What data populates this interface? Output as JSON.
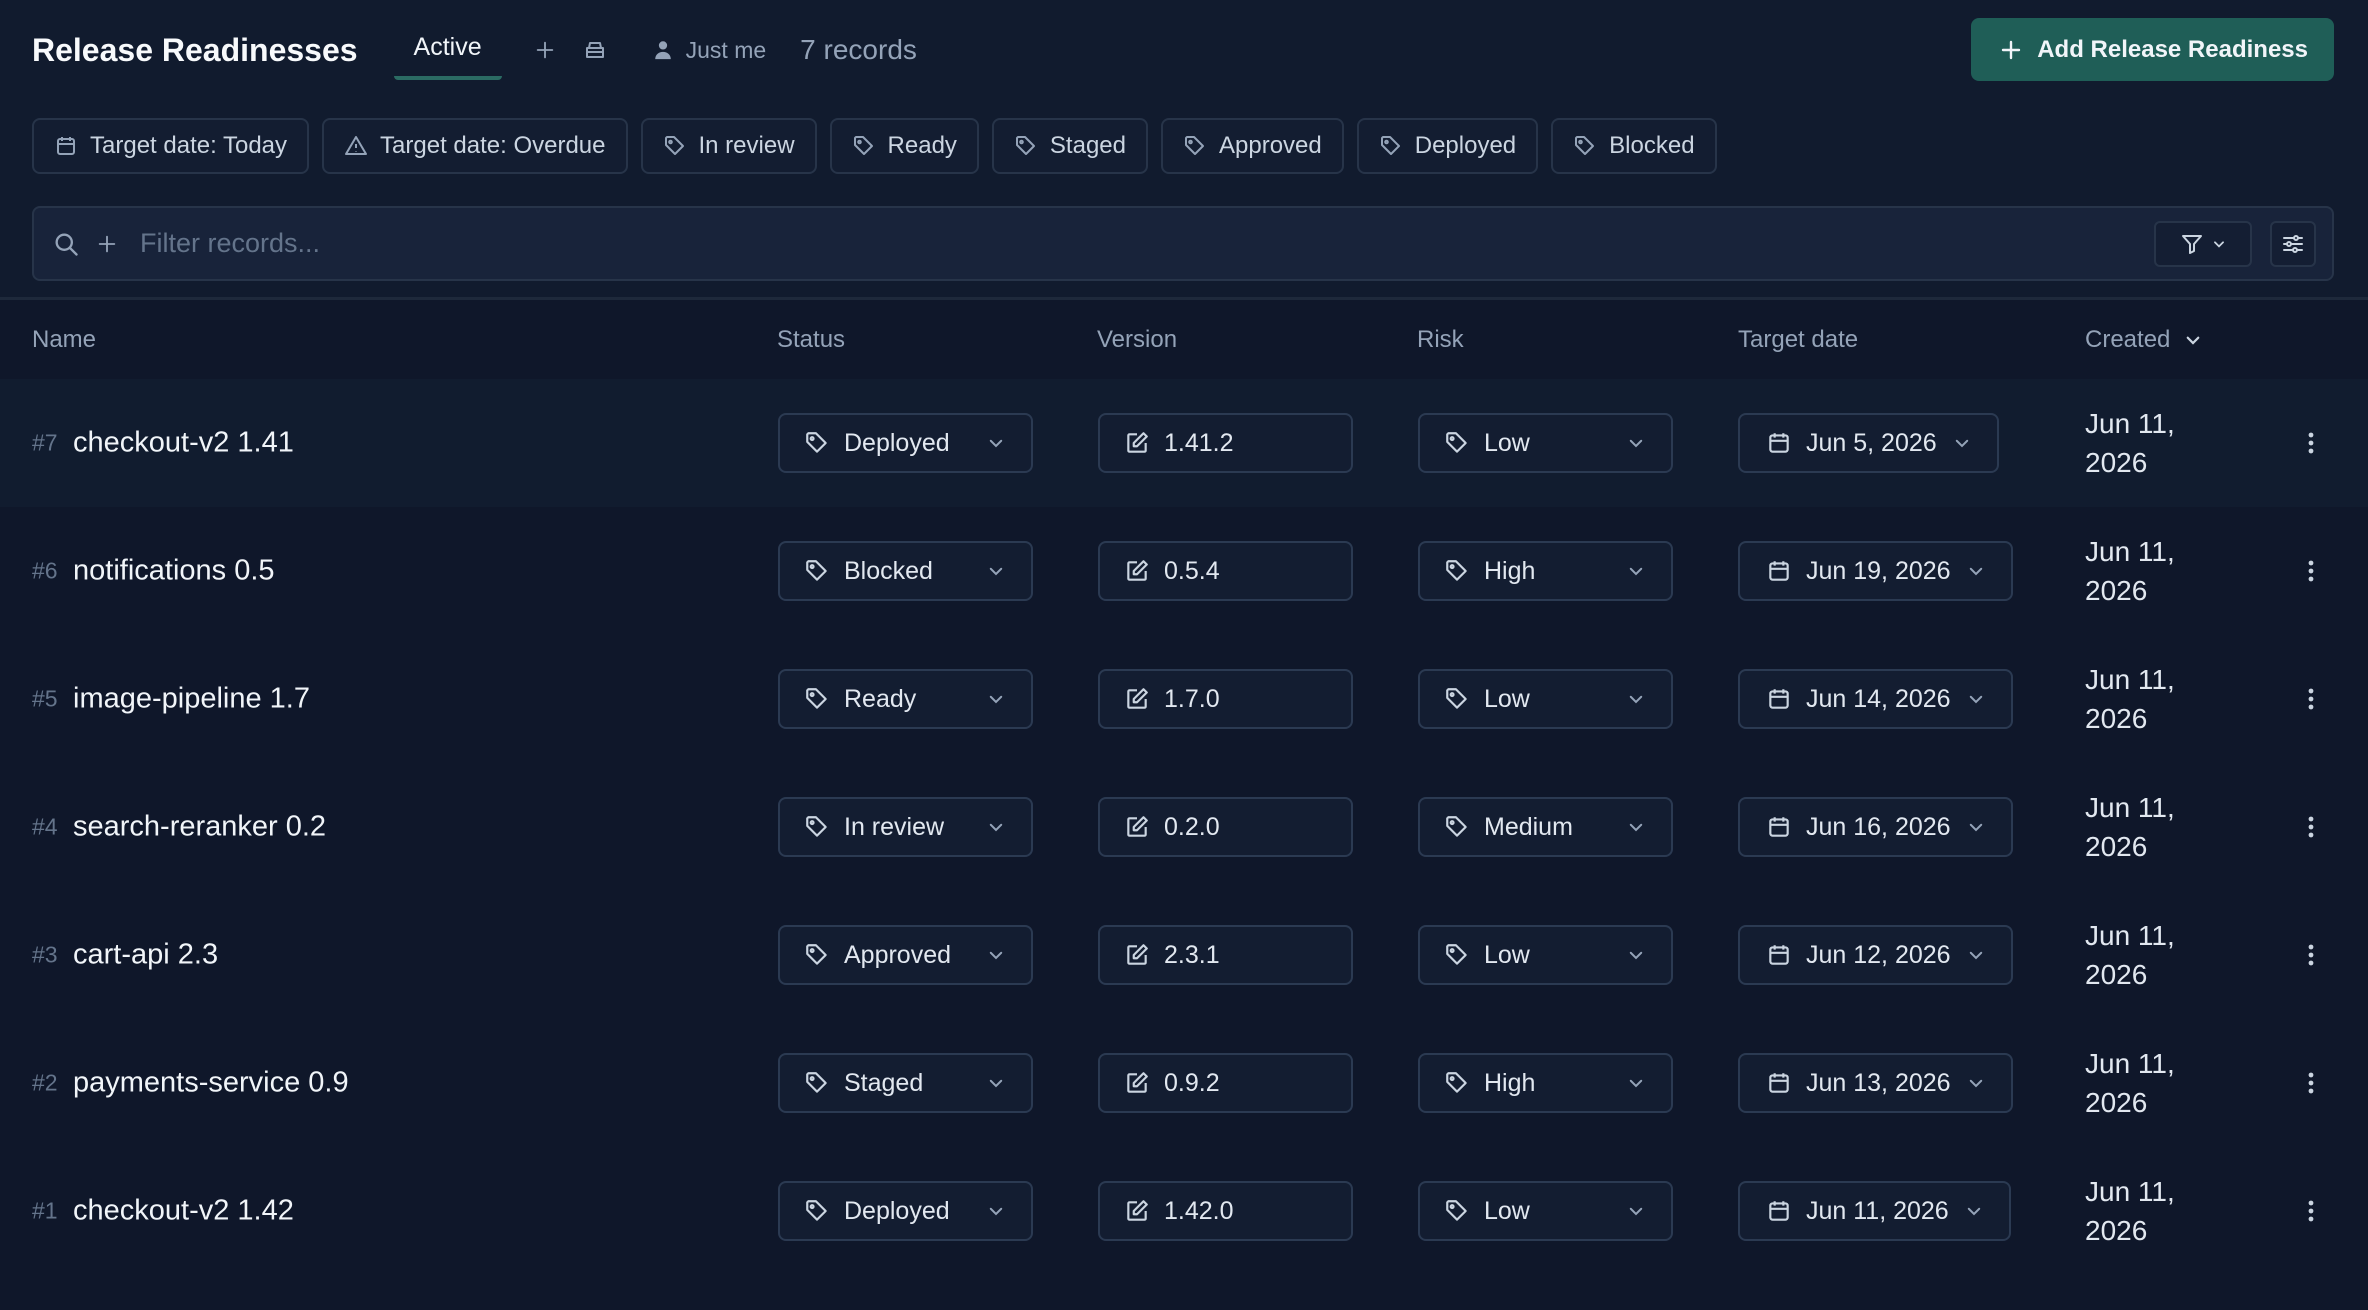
{
  "header": {
    "title": "Release Readinesses",
    "active_tab": "Active",
    "owner_filter": "Just me",
    "record_count": "7 records",
    "add_button": "Add Release Readiness"
  },
  "quick_filters": [
    {
      "label": "Target date: Today",
      "icon": "calendar-icon"
    },
    {
      "label": "Target date: Overdue",
      "icon": "warning-icon"
    },
    {
      "label": "In review",
      "icon": "tag-icon"
    },
    {
      "label": "Ready",
      "icon": "tag-icon"
    },
    {
      "label": "Staged",
      "icon": "tag-icon"
    },
    {
      "label": "Approved",
      "icon": "tag-icon"
    },
    {
      "label": "Deployed",
      "icon": "tag-icon"
    },
    {
      "label": "Blocked",
      "icon": "tag-icon"
    }
  ],
  "search": {
    "placeholder": "Filter records...",
    "value": ""
  },
  "columns": {
    "name": "Name",
    "status": "Status",
    "version": "Version",
    "risk": "Risk",
    "target_date": "Target date",
    "created": "Created"
  },
  "rows": [
    {
      "id": "#7",
      "name": "checkout-v2 1.41",
      "status": "Deployed",
      "version": "1.41.2",
      "risk": "Low",
      "target_date": "Jun 5, 2026",
      "created_line1": "Jun 11,",
      "created_line2": "2026"
    },
    {
      "id": "#6",
      "name": "notifications 0.5",
      "status": "Blocked",
      "version": "0.5.4",
      "risk": "High",
      "target_date": "Jun 19, 2026",
      "created_line1": "Jun 11,",
      "created_line2": "2026"
    },
    {
      "id": "#5",
      "name": "image-pipeline 1.7",
      "status": "Ready",
      "version": "1.7.0",
      "risk": "Low",
      "target_date": "Jun 14, 2026",
      "created_line1": "Jun 11,",
      "created_line2": "2026"
    },
    {
      "id": "#4",
      "name": "search-reranker 0.2",
      "status": "In review",
      "version": "0.2.0",
      "risk": "Medium",
      "target_date": "Jun 16, 2026",
      "created_line1": "Jun 11,",
      "created_line2": "2026"
    },
    {
      "id": "#3",
      "name": "cart-api 2.3",
      "status": "Approved",
      "version": "2.3.1",
      "risk": "Low",
      "target_date": "Jun 12, 2026",
      "created_line1": "Jun 11,",
      "created_line2": "2026"
    },
    {
      "id": "#2",
      "name": "payments-service 0.9",
      "status": "Staged",
      "version": "0.9.2",
      "risk": "High",
      "target_date": "Jun 13, 2026",
      "created_line1": "Jun 11,",
      "created_line2": "2026"
    },
    {
      "id": "#1",
      "name": "checkout-v2 1.42",
      "status": "Deployed",
      "version": "1.42.0",
      "risk": "Low",
      "target_date": "Jun 11, 2026",
      "created_line1": "Jun 11,",
      "created_line2": "2026"
    }
  ],
  "colors": {
    "background": "#0f172a",
    "accent": "#1f5e57",
    "border": "#273449"
  }
}
